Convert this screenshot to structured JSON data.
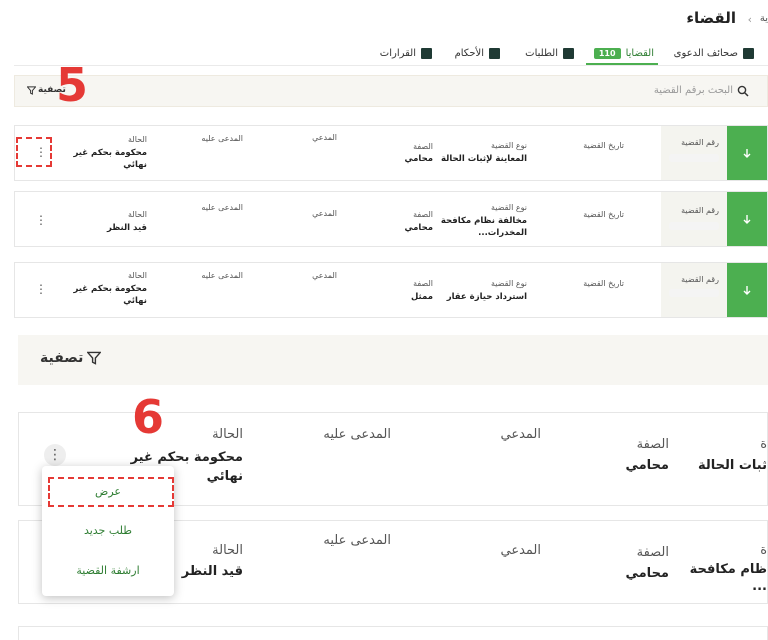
{
  "header": {
    "title": "القضاء",
    "breadcrumb_prev": "ية",
    "breadcrumb_sep": "‹"
  },
  "tabs": [
    {
      "label": "صحائف الدعوى"
    },
    {
      "label": "القضايا",
      "badge": "110"
    },
    {
      "label": "الطلبات"
    },
    {
      "label": "الأحكام"
    },
    {
      "label": "القرارات"
    }
  ],
  "search": {
    "placeholder": "البحث برقم القضية",
    "filter_label": "تصفية"
  },
  "labels": {
    "case_number": "رقم القضية",
    "case_date": "تاريخ القضية",
    "case_type": "نوع القضية",
    "capacity": "الصفة",
    "plaintiff": "المدعي",
    "defendant": "المدعى عليه",
    "status": "الحالة"
  },
  "cases": [
    {
      "type": "المعاينة لإثبات الحالة",
      "type2": "",
      "capacity": "محامي",
      "status": "محكومة بحكم غير",
      "status2": "نهائي"
    },
    {
      "type": "مخالفة نظام مكافحة",
      "type2": "المخدرات...",
      "capacity": "محامي",
      "status": "قيد النظر",
      "status2": ""
    },
    {
      "type": "استرداد حيازة عقار",
      "type2": "",
      "capacity": "ممثل",
      "status": "محكومة بحكم غير",
      "status2": "نهائي"
    }
  ],
  "zoom": {
    "filter_label": "تصفية",
    "card1": {
      "type_part": "ثبات الحالة",
      "capacity": "محامي",
      "status": "محكومة بحكم غير",
      "status2": "نهائي",
      "label_head": "ة"
    },
    "card2": {
      "type_part": "ظام مكافحة",
      "type_part2": "...",
      "capacity": "محامي",
      "status": "قيد النظر",
      "label_head": "ة"
    }
  },
  "menu": {
    "items": [
      "عرض",
      "طلب جديد",
      "ارشفة القضية"
    ]
  },
  "annotations": {
    "step5": "5",
    "step6": "6"
  },
  "colors": {
    "accent": "#4caf50",
    "dark_tab": "#1f3a34",
    "annotation": "#e53935"
  }
}
